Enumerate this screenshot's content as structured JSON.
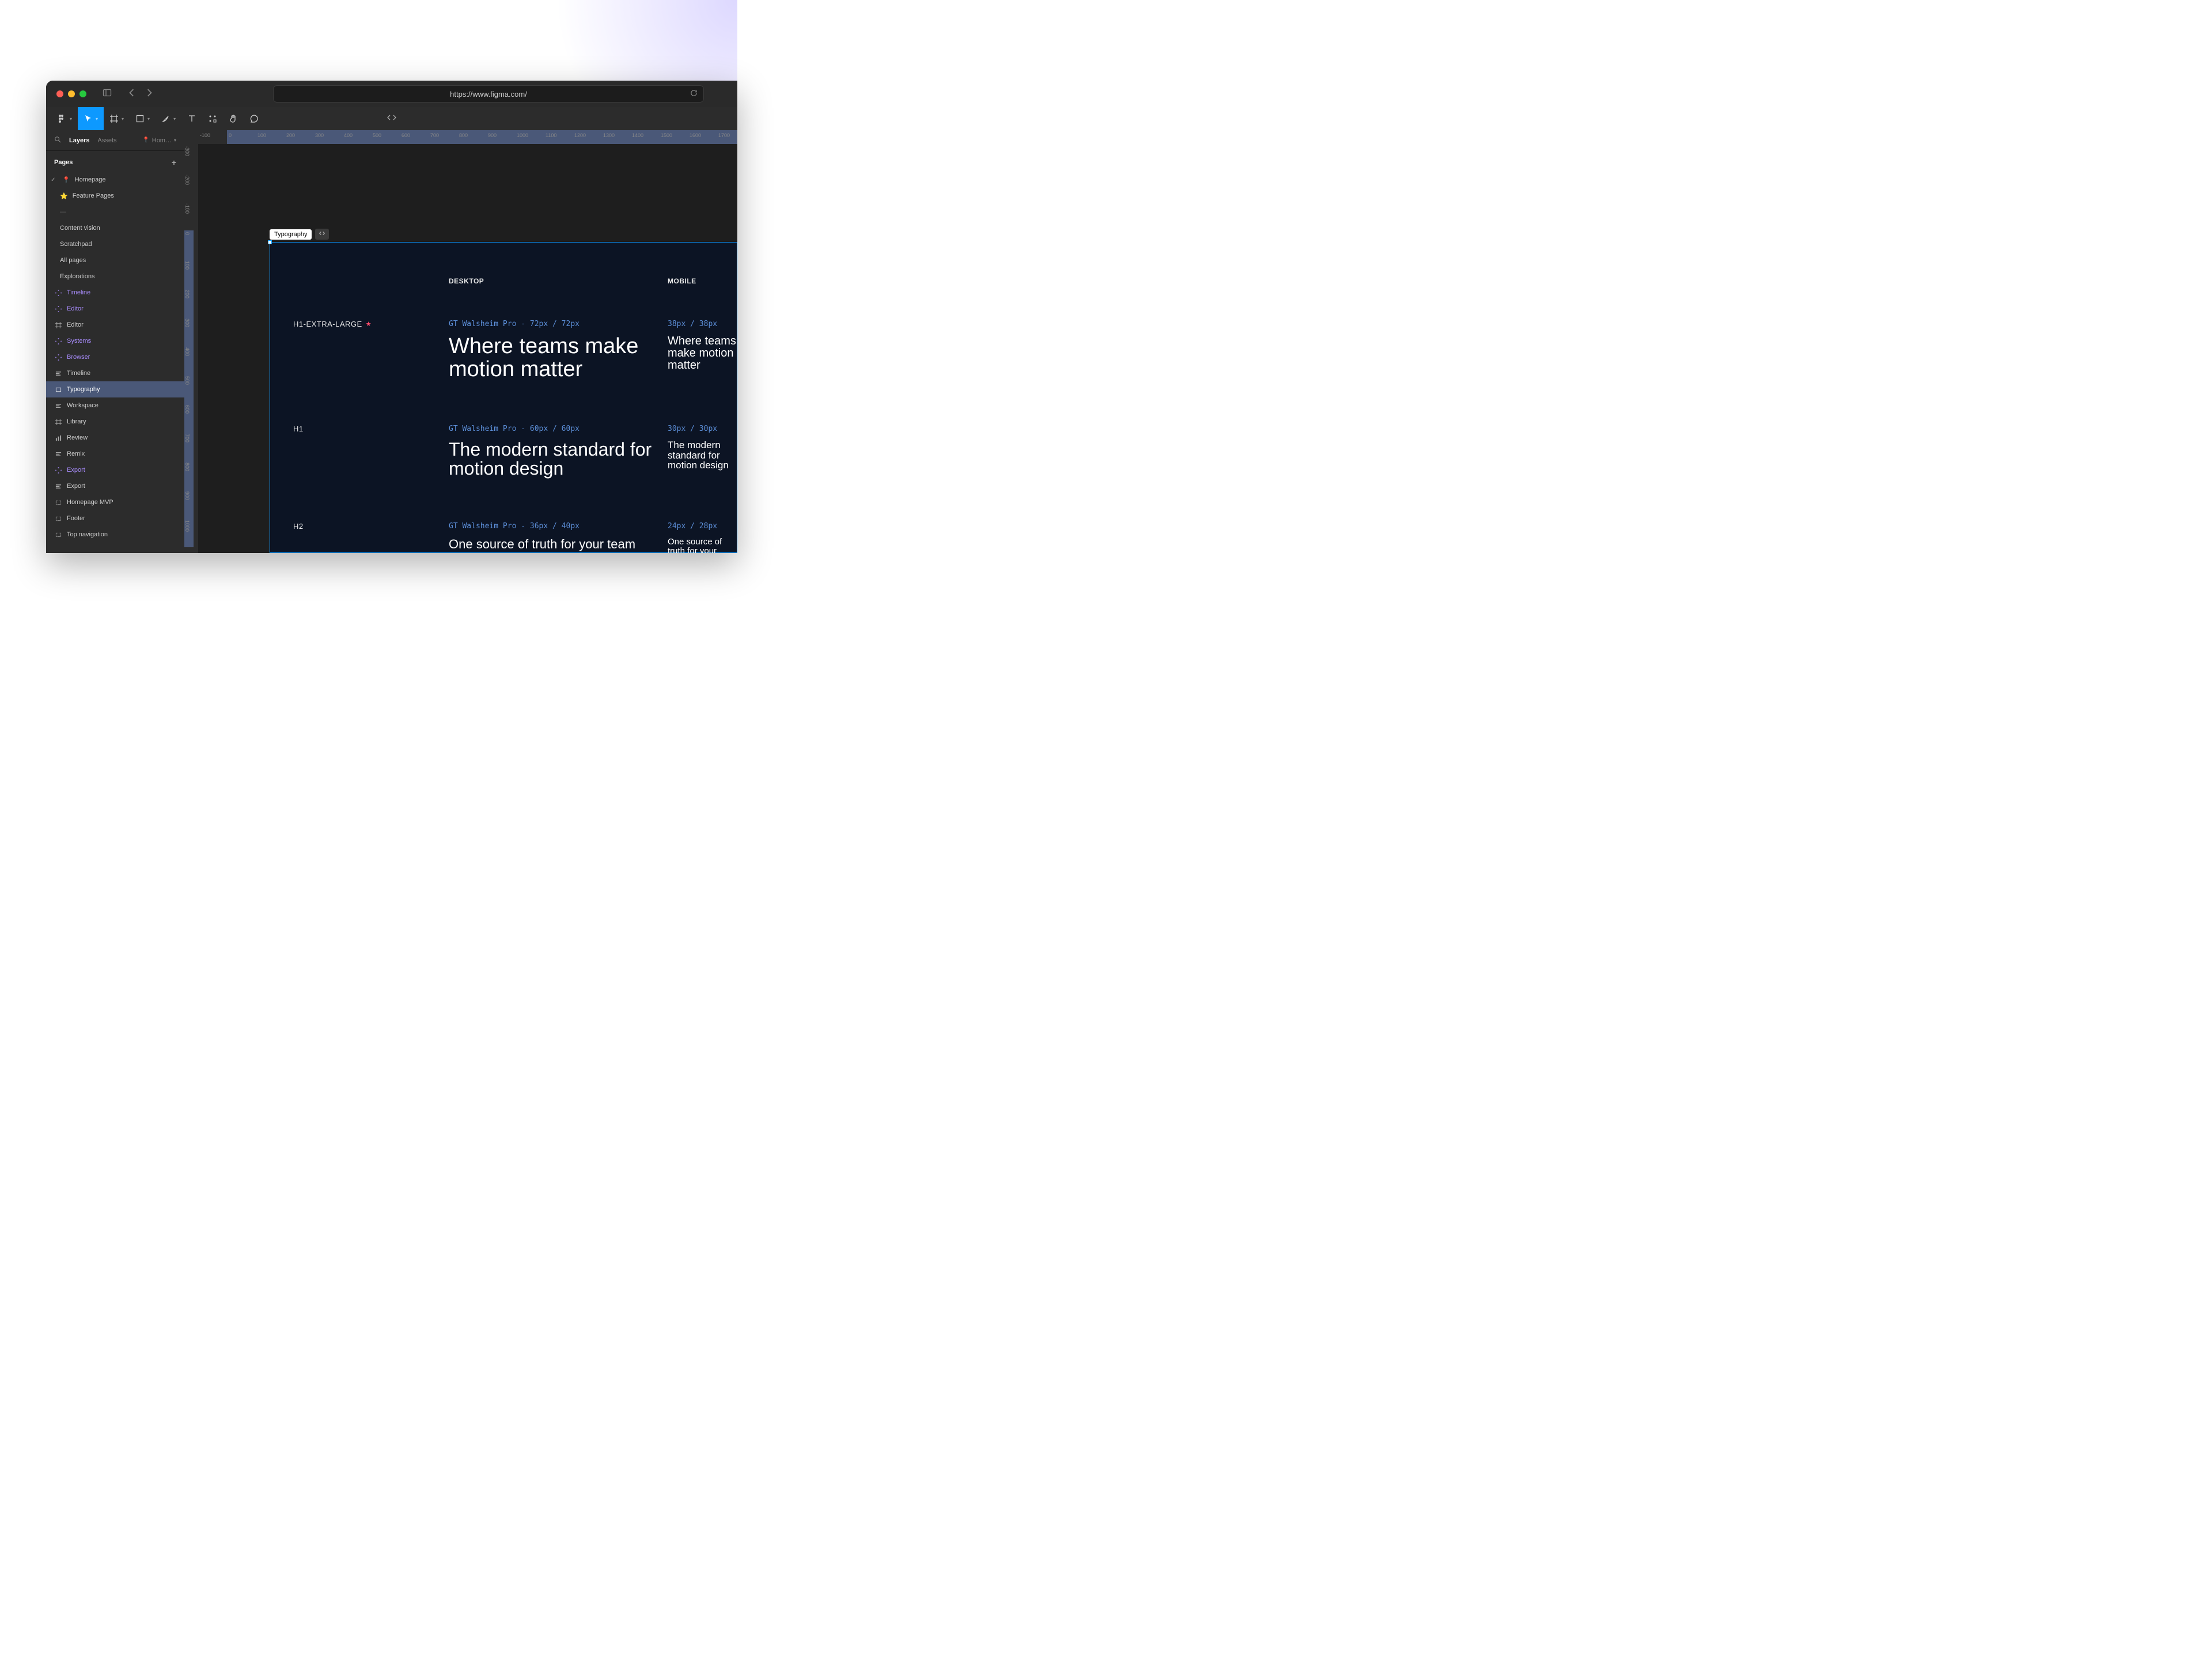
{
  "browser": {
    "url": "https://www.figma.com/"
  },
  "panel": {
    "tabs": {
      "layers": "Layers",
      "assets": "Assets"
    },
    "pageDropdown": "Hom…",
    "pagesHeader": "Pages",
    "pages": [
      {
        "label": "Homepage",
        "emoji": "📍",
        "checked": true
      },
      {
        "label": "Feature Pages",
        "emoji": "⭐"
      },
      {
        "label": "—",
        "dash": true
      },
      {
        "label": "Content vision"
      },
      {
        "label": "Scratchpad"
      },
      {
        "label": "All pages"
      },
      {
        "label": "Explorations"
      }
    ],
    "layers": [
      {
        "name": "Timeline",
        "icon": "component",
        "purple": true
      },
      {
        "name": "Editor",
        "icon": "component",
        "purple": true
      },
      {
        "name": "Editor",
        "icon": "frame"
      },
      {
        "name": "Systems",
        "icon": "component",
        "purple": true
      },
      {
        "name": "Browser",
        "icon": "component",
        "purple": true
      },
      {
        "name": "Timeline",
        "icon": "lines"
      },
      {
        "name": "Typography",
        "icon": "rect",
        "selected": true
      },
      {
        "name": "Workspace",
        "icon": "lines"
      },
      {
        "name": "Library",
        "icon": "frame"
      },
      {
        "name": "Review",
        "icon": "bars"
      },
      {
        "name": "Remix",
        "icon": "lines"
      },
      {
        "name": "Export",
        "icon": "component",
        "purple": true
      },
      {
        "name": "Export",
        "icon": "lines"
      },
      {
        "name": "Homepage MVP",
        "icon": "rect-outline"
      },
      {
        "name": "Footer",
        "icon": "rect-outline"
      },
      {
        "name": "Top navigation",
        "icon": "rect-outline"
      }
    ]
  },
  "rulerH": [
    "-100",
    "0",
    "100",
    "200",
    "300",
    "400",
    "500",
    "600",
    "700",
    "800",
    "900",
    "1000",
    "1100",
    "1200",
    "1300",
    "1400",
    "1500",
    "1600",
    "1700"
  ],
  "rulerV": [
    "-300",
    "-200",
    "-100",
    "0",
    "100",
    "200",
    "300",
    "400",
    "500",
    "600",
    "700",
    "800",
    "900",
    "1000"
  ],
  "frame": {
    "label": "Typography",
    "devIcon": "⟨⟩"
  },
  "typo": {
    "headers": {
      "desktop": "DESKTOP",
      "mobile": "MOBILE"
    },
    "rows": [
      {
        "label": "H1-EXTRA-LARGE",
        "star": true,
        "desktop": {
          "spec": "GT Walsheim Pro - 72px / 72px",
          "sample": "Where teams make motion matter"
        },
        "mobile": {
          "spec": "38px / 38px",
          "sample": "Where teams make motion matter"
        }
      },
      {
        "label": "H1",
        "desktop": {
          "spec": "GT Walsheim Pro - 60px / 60px",
          "sample": "The modern standard for motion design"
        },
        "mobile": {
          "spec": "30px / 30px",
          "sample": "The modern standard for motion design"
        }
      },
      {
        "label": "H2",
        "desktop": {
          "spec": "GT Walsheim Pro - 36px / 40px",
          "sample": "One source of truth for your team"
        },
        "mobile": {
          "spec": "24px / 28px",
          "sample": "One source of truth for your team"
        }
      }
    ]
  }
}
